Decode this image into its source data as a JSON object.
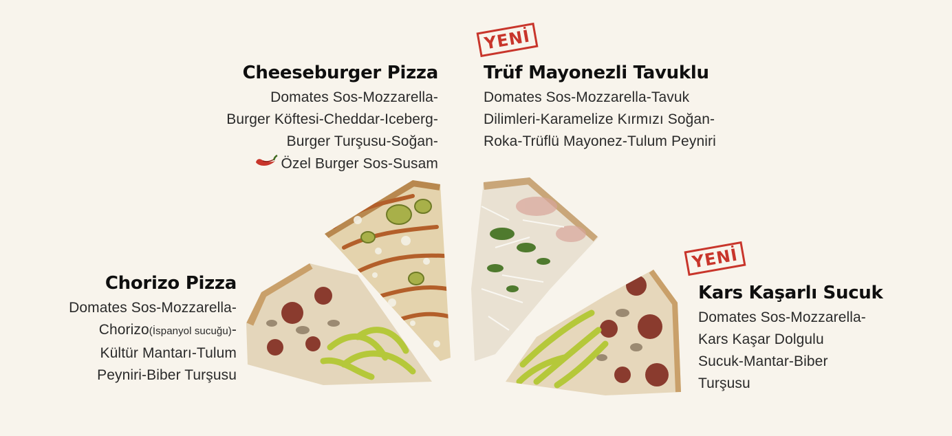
{
  "items": {
    "cheeseburger": {
      "title": "Cheeseburger Pizza",
      "lines": [
        "Domates Sos-Mozzarella-",
        "Burger Köftesi-Cheddar-Iceberg-",
        "Burger Turşusu-Soğan-",
        "Özel Burger Sos-Susam"
      ],
      "spicy_icon": "chili-pepper-icon"
    },
    "truf": {
      "badge": "YENİ",
      "title": "Trüf Mayonezli Tavuklu",
      "lines": [
        "Domates Sos-Mozzarella-Tavuk",
        "Dilimleri-Karamelize Kırmızı Soğan-",
        "Roka-Trüflü Mayonez-Tulum Peyniri"
      ]
    },
    "chorizo": {
      "title": "Chorizo Pizza",
      "lines": [
        "Domates Sos-Mozzarella-",
        "Chorizo",
        "(İspanyol sucuğu)",
        "-",
        "Kültür Mantarı-Tulum",
        "Peyniri-Biber Turşusu"
      ]
    },
    "kars": {
      "badge": "YENİ",
      "title": "Kars Kaşarlı Sucuk",
      "lines": [
        "Domates Sos-Mozzarella-",
        "Kars Kaşar Dolgulu",
        "Sucuk-Mantar-Biber",
        "Turşusu"
      ]
    }
  },
  "colors": {
    "background": "#f8f4ec",
    "badge_red": "#c8352b",
    "crust": "#d9b98a",
    "cheese": "#eadcc0",
    "pepper_green": "#b5c83a",
    "sausage": "#8a3b2e",
    "arugula": "#4f7a2e"
  }
}
